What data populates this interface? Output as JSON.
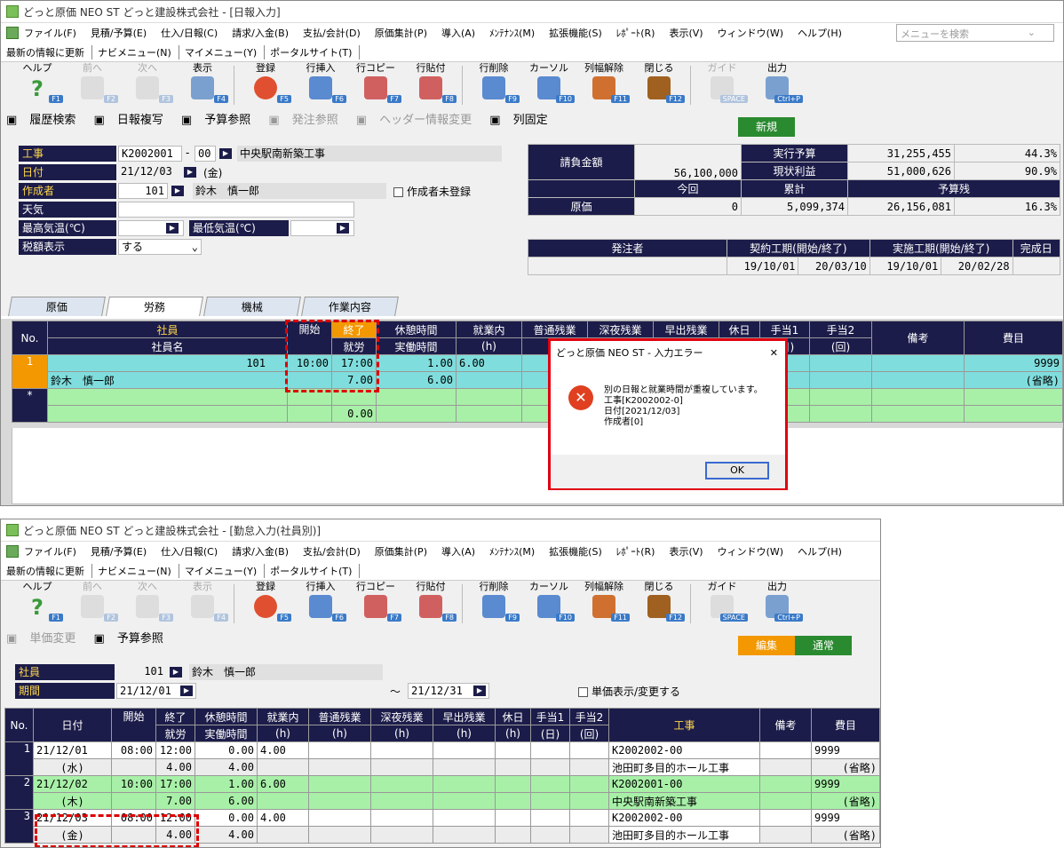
{
  "w1": {
    "title": "どっと原価 NEO ST どっと建設株式会社 - [日報入力]",
    "menu": [
      "ファイル(F)",
      "見積/予算(E)",
      "仕入/日報(C)",
      "請求/入金(B)",
      "支払/会計(D)",
      "原価集計(P)",
      "導入(A)",
      "ﾒﾝﾃﾅﾝｽ(M)",
      "拡張機能(S)",
      "ﾚﾎﾟｰﾄ(R)",
      "表示(V)",
      "ウィンドウ(W)",
      "ヘルプ(H)"
    ],
    "search_placeholder": "メニューを検索",
    "links": [
      "最新の情報に更新",
      "ナビメニュー(N)",
      "マイメニュー(Y)",
      "ポータルサイト(T)"
    ],
    "toolbar": [
      {
        "label": "ヘルプ",
        "key": "F1",
        "icon": "help-icon",
        "color": "#3a9a3a"
      },
      {
        "label": "前へ",
        "key": "F2",
        "icon": "prev-icon",
        "color": "#bbb",
        "dis": true
      },
      {
        "label": "次へ",
        "key": "F3",
        "icon": "next-icon",
        "color": "#bbb",
        "dis": true
      },
      {
        "label": "表示",
        "key": "F4",
        "icon": "magnifier-icon",
        "color": "#7aa0d0"
      },
      {
        "label": "登録",
        "key": "F5",
        "icon": "ok-icon",
        "color": "#e05030"
      },
      {
        "label": "行挿入",
        "key": "F6",
        "icon": "row-insert-icon",
        "color": "#5a8ad0"
      },
      {
        "label": "行コピー",
        "key": "F7",
        "icon": "row-copy-icon",
        "color": "#d06060"
      },
      {
        "label": "行貼付",
        "key": "F8",
        "icon": "row-paste-icon",
        "color": "#d06060"
      },
      {
        "label": "行削除",
        "key": "F9",
        "icon": "row-delete-icon",
        "color": "#5a8ad0"
      },
      {
        "label": "カーソル",
        "key": "F10",
        "icon": "cursor-icon",
        "color": "#5a8ad0"
      },
      {
        "label": "列幅解除",
        "key": "F11",
        "icon": "column-width-icon",
        "color": "#d07030"
      },
      {
        "label": "閉じる",
        "key": "F12",
        "icon": "door-icon",
        "color": "#a06020"
      },
      {
        "label": "ガイド",
        "key": "SPACE",
        "icon": "bulb-icon",
        "color": "#ddd",
        "dis": true
      },
      {
        "label": "出力",
        "key": "Ctrl+P",
        "icon": "printer-icon",
        "color": "#7aa0d0"
      }
    ],
    "subbar": [
      "履歴検索",
      "日報複写",
      "予算参照",
      "発注参照",
      "ヘッダー情報変更",
      "列固定"
    ],
    "new_btn": "新規",
    "form": {
      "koji_label": "工事",
      "koji_code": "K2002001",
      "koji_sep": "-",
      "koji_sub": "00",
      "koji_name": "中央駅南新築工事",
      "date_label": "日付",
      "date": "21/12/03",
      "weekday": "(金)",
      "author_label": "作成者",
      "author_code": "101",
      "author_name": "鈴木　慎一郎",
      "author_unreg": "作成者未登録",
      "weather_label": "天気",
      "tmax_label": "最高気温(℃)",
      "tmin_label": "最低気温(℃)",
      "tax_label": "税額表示",
      "tax_value": "する"
    },
    "summary": {
      "contract_label": "請負金額",
      "contract_value": "56,100,000",
      "exec_label": "実行予算",
      "exec_value": "31,255,455",
      "exec_pct": "44.3%",
      "profit_label": "現状利益",
      "profit_value": "51,000,626",
      "profit_pct": "90.9%",
      "now_label": "今回",
      "total_label": "累計",
      "remain_label": "予算残",
      "cost_label": "原価",
      "cost_now": "0",
      "cost_total": "5,099,374",
      "cost_remain": "26,156,081",
      "cost_pct": "16.3%"
    },
    "period": {
      "orderer_label": "発注者",
      "contract_period_label": "契約工期(開始/終了)",
      "actual_period_label": "実施工期(開始/終了)",
      "complete_label": "完成日",
      "c_start": "19/10/01",
      "c_end": "20/03/10",
      "a_start": "19/10/01",
      "a_end": "20/02/28"
    },
    "tabs": [
      "原価",
      "労務",
      "機械",
      "作業内容"
    ],
    "grid_head": {
      "no": "No.",
      "emp": "社員",
      "emp_name": "社員名",
      "start": "開始",
      "end": "終了",
      "work": "就労",
      "rest": "休憩時間",
      "actual": "実働時間",
      "inner": "就業内",
      "inner2": "(h)",
      "normal": "普通残業",
      "late": "深夜残業",
      "early": "早出残業",
      "holiday": "休日",
      "a1": "手当1",
      "a1b": "(日)",
      "a2": "手当2",
      "a2b": "(回)",
      "note": "備考",
      "item": "費目"
    },
    "row": {
      "no": "1",
      "code": "101",
      "name": "鈴木　慎一郎",
      "start": "10:00",
      "end": "17:00",
      "work": "7.00",
      "rest": "1.00",
      "actual": "6.00",
      "inner": "6.00",
      "item": "9999",
      "item_sub": "(省略)"
    },
    "newrow": {
      "mark": "*",
      "work": "0.00"
    },
    "dialog": {
      "title": "どっと原価 NEO ST - 入力エラー",
      "lines": [
        "別の日報と就業時間が重複しています。",
        "工事[K2002002-0]",
        "日付[2021/12/03]",
        "作成者[0]"
      ],
      "ok": "OK"
    }
  },
  "w2": {
    "title": "どっと原価 NEO ST どっと建設株式会社 - [勤怠入力(社員別)]",
    "subbar": [
      "単価変更",
      "予算参照"
    ],
    "edit_btn": "編集",
    "normal_btn": "通常",
    "emp_label": "社員",
    "emp_code": "101",
    "emp_name": "鈴木　慎一郎",
    "period_label": "期間",
    "from": "21/12/01",
    "tilde": "～",
    "to": "21/12/31",
    "unit_chk": "単価表示/変更する",
    "head": {
      "no": "No.",
      "date": "日付",
      "start": "開始",
      "end": "終了",
      "work": "就労",
      "rest": "休憩時間",
      "actual": "実働時間",
      "inner": "就業内",
      "normal": "普通残業",
      "late": "深夜残業",
      "early": "早出残業",
      "holiday": "休日",
      "a1": "手当1",
      "a2": "手当2",
      "h": "(h)",
      "d": "(日)",
      "t": "(回)",
      "koji": "工事",
      "note": "備考",
      "item": "費目"
    },
    "rows": [
      {
        "no": "1",
        "date": "21/12/01",
        "wd": "(水)",
        "start": "08:00",
        "end": "12:00",
        "work": "4.00",
        "rest": "0.00",
        "actual": "4.00",
        "inner": "4.00",
        "koji": "K2002002-00",
        "kname": "池田町多目的ホール工事",
        "item": "9999",
        "item2": "(省略)"
      },
      {
        "no": "2",
        "date": "21/12/02",
        "wd": "(木)",
        "start": "10:00",
        "end": "17:00",
        "work": "7.00",
        "rest": "1.00",
        "actual": "6.00",
        "inner": "6.00",
        "koji": "K2002001-00",
        "kname": "中央駅南新築工事",
        "item": "9999",
        "item2": "(省略)"
      },
      {
        "no": "3",
        "date": "21/12/03",
        "wd": "(金)",
        "start": "08:00",
        "end": "12:00",
        "work": "4.00",
        "rest": "0.00",
        "actual": "4.00",
        "inner": "4.00",
        "koji": "K2002002-00",
        "kname": "池田町多目的ホール工事",
        "item": "9999",
        "item2": "(省略)"
      }
    ]
  }
}
